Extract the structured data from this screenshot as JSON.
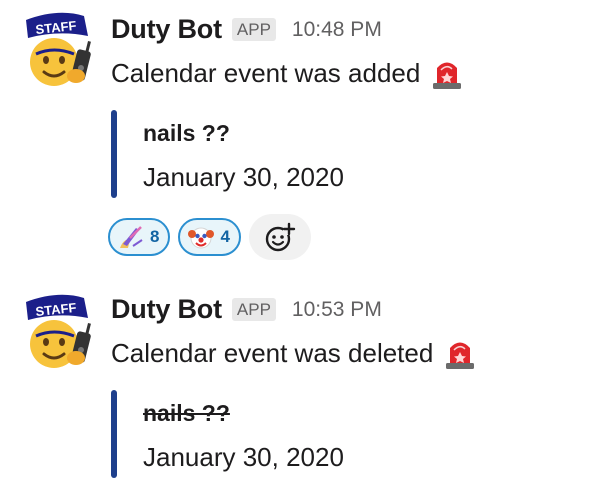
{
  "messages": [
    {
      "sender": "Duty Bot",
      "badge": "APP",
      "time": "10:48 PM",
      "text": "Calendar event was added",
      "avatar_icon": "staff-emoji-avatar",
      "trailing_icon": "rotating-light-icon",
      "attachment": {
        "title": "nails ??",
        "date": "January 30, 2020",
        "strikethrough": false
      },
      "reactions": [
        {
          "icon": "nail-polish-icon",
          "count": "8"
        },
        {
          "icon": "clown-face-icon",
          "count": "4"
        }
      ],
      "add_reaction_icon": "add-reaction-icon"
    },
    {
      "sender": "Duty Bot",
      "badge": "APP",
      "time": "10:53 PM",
      "text": "Calendar event was deleted",
      "avatar_icon": "staff-emoji-avatar",
      "trailing_icon": "rotating-light-icon",
      "attachment": {
        "title": "nails ??",
        "date": "January 30, 2020",
        "strikethrough": true
      }
    }
  ],
  "colors": {
    "attachment_bar": "#1e3f8c",
    "reaction_border": "#2b8fd0",
    "reaction_bg": "#e8f5fa",
    "reaction_count": "#1264a3",
    "badge_bg": "#e8e8e8",
    "muted_text": "#616061"
  }
}
